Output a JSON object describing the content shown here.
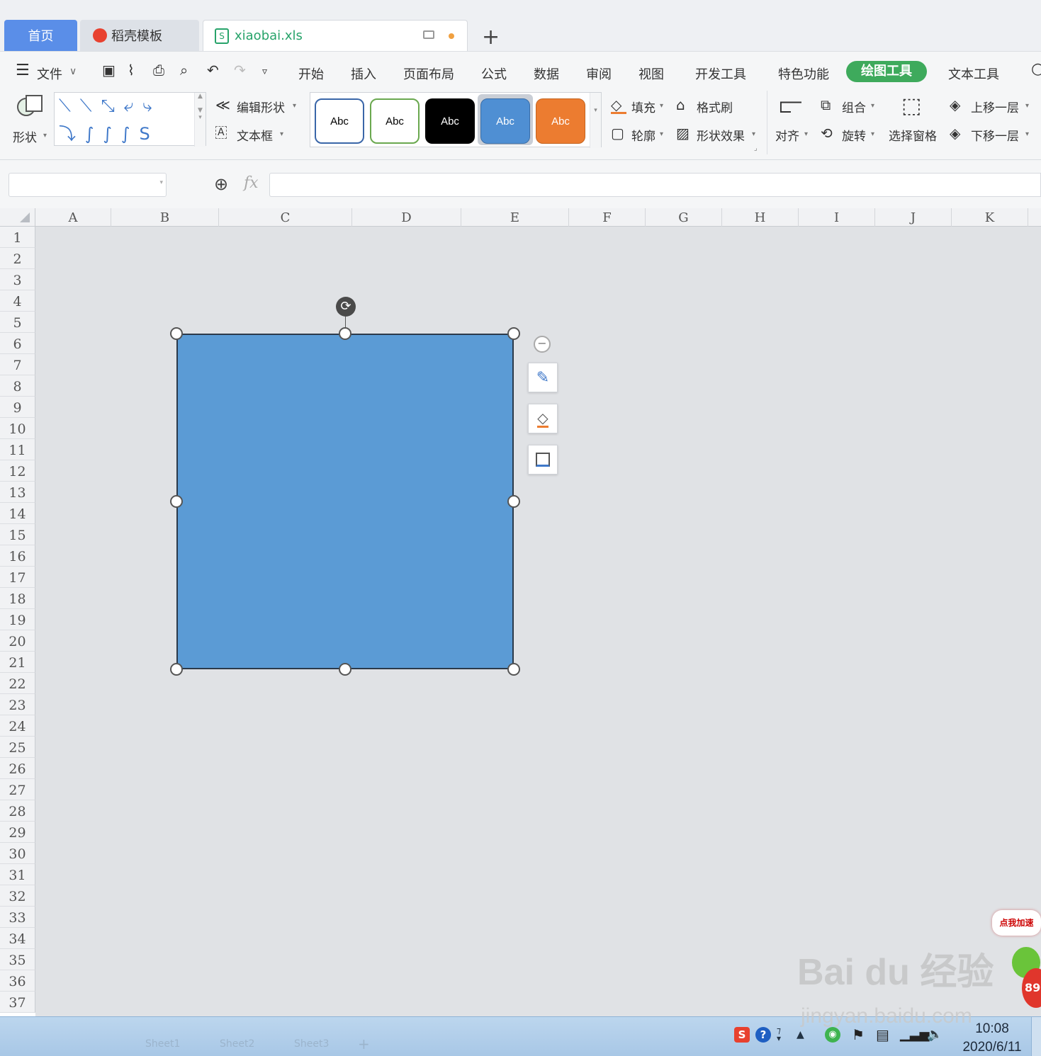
{
  "tabs": {
    "home": "首页",
    "daoke": "稻壳模板",
    "file": "xiaobai.xls",
    "add": "+"
  },
  "menu": {
    "file": "文件",
    "items": [
      "开始",
      "插入",
      "页面布局",
      "公式",
      "数据",
      "审阅",
      "视图",
      "开发工具",
      "特色功能"
    ],
    "active": "绘图工具",
    "text_tools": "文本工具"
  },
  "ribbon": {
    "shape": "形状",
    "edit_shape": "编辑形状",
    "text_box": "文本框",
    "abc": "Abc",
    "fill": "填充",
    "outline": "轮廓",
    "format_painter": "格式刷",
    "shape_effect": "形状效果",
    "align": "对齐",
    "group": "组合",
    "rotate": "旋转",
    "selection_pane": "选择窗格",
    "bring_forward": "上移一层",
    "send_backward": "下移一层"
  },
  "formula": {
    "fx": "fx",
    "name_value": "",
    "formula_value": ""
  },
  "columns": [
    "A",
    "B",
    "C",
    "D",
    "E",
    "F",
    "G",
    "H",
    "I",
    "J",
    "K"
  ],
  "rows": [
    "1",
    "2",
    "3",
    "4",
    "5",
    "6",
    "7",
    "8",
    "9",
    "10",
    "11",
    "12",
    "13",
    "14",
    "15",
    "16",
    "17",
    "18",
    "19",
    "20",
    "21",
    "22",
    "23",
    "24",
    "25",
    "26",
    "27",
    "28",
    "29",
    "30",
    "31",
    "32",
    "33",
    "34",
    "35",
    "36",
    "37"
  ],
  "shape": {
    "fill_color": "#5b9bd5"
  },
  "taskbar": {
    "time": "10:08",
    "date": "2020/6/11",
    "sheets": [
      "Sheet1",
      "Sheet2",
      "Sheet3"
    ]
  },
  "watermark": {
    "brand": "Bai du 经验",
    "url": "jingyan.baidu.com"
  },
  "promo": {
    "label": "点我加速",
    "badge": "89"
  }
}
